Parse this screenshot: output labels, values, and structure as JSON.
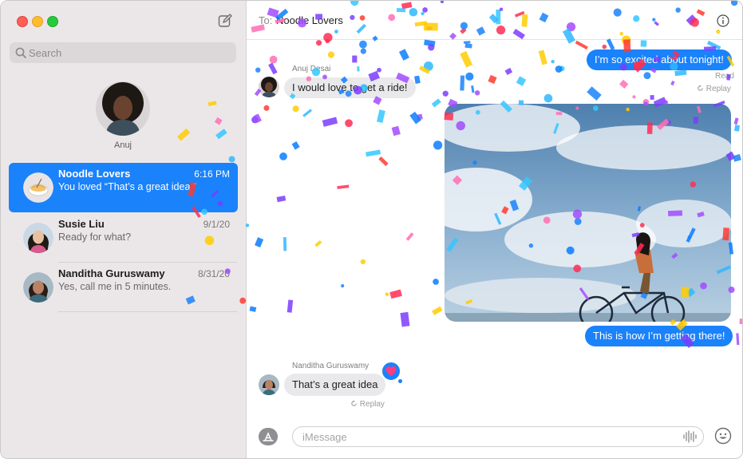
{
  "sidebar": {
    "search_placeholder": "Search",
    "pinned": {
      "name": "Anuj"
    },
    "conversations": [
      {
        "name": "Noodle Lovers",
        "date": "6:16 PM",
        "preview": "You loved “That’s a great idea ”",
        "selected": true
      },
      {
        "name": "Susie Liu",
        "date": "9/1/20",
        "preview": "Ready for what?"
      },
      {
        "name": "Nanditha Guruswamy",
        "date": "8/31/20",
        "preview": "Yes, call me in 5 minutes."
      }
    ]
  },
  "header": {
    "to_label": "To:",
    "recipient": "Noodle Lovers"
  },
  "messages": {
    "m1": {
      "text": "I’m so excited about tonight!"
    },
    "m2": {
      "sender": "Anuj Desai",
      "text": "I would love to get a ride!"
    },
    "read_label": "Read",
    "replay1": "Replay",
    "m3": {
      "text": "This is how I’m getting there!"
    },
    "m4": {
      "sender": "Nanditha Guruswamy",
      "text": "That’s a great idea"
    },
    "replay2": "Replay"
  },
  "composer": {
    "placeholder": "iMessage"
  },
  "colors": {
    "accent": "#1a82fb",
    "bubble_gray": "#e9e9eb",
    "sidebar_bg": "#ebe7e9"
  },
  "icons": [
    "compose-icon",
    "search-icon",
    "info-icon",
    "heart-icon",
    "replay-icon",
    "app-store-icon",
    "audio-wave-icon",
    "emoji-icon"
  ]
}
